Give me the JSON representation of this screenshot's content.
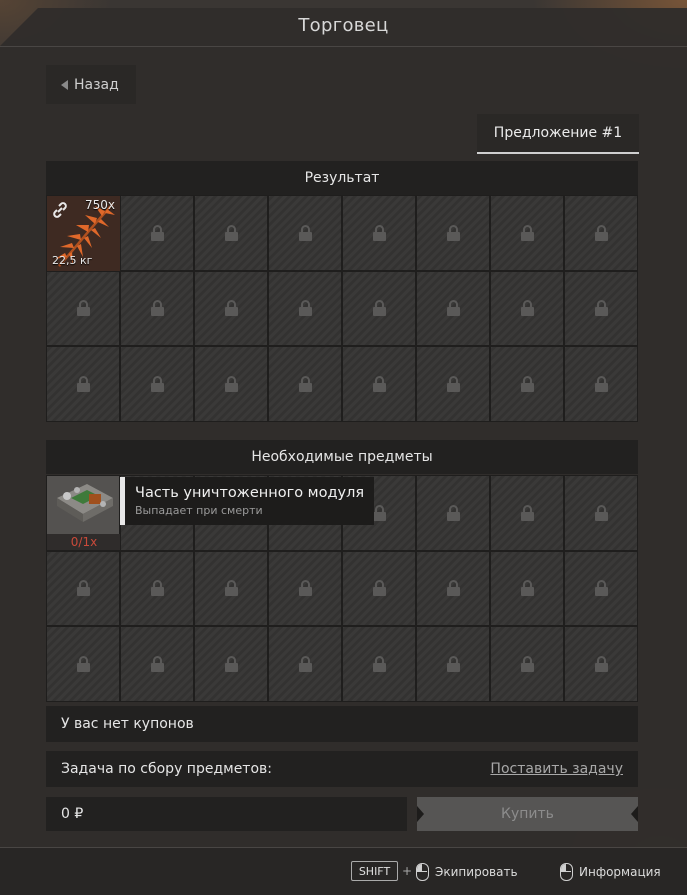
{
  "window": {
    "title": "Торговец"
  },
  "nav": {
    "back_label": "Назад"
  },
  "tabs": [
    {
      "label": "Предложение #1",
      "active": true
    }
  ],
  "result": {
    "header": "Результат",
    "item": {
      "icon": "fern-icon",
      "quantity": "750x",
      "weight": "22,5 кг",
      "linked": true
    },
    "locked_slot_icon": "lock-icon"
  },
  "required": {
    "header": "Необходимые предметы",
    "item": {
      "icon": "module-icon",
      "count": "0/1x",
      "count_color": "#c94a3a"
    },
    "tooltip": {
      "title": "Часть уничтоженного модуля",
      "subtitle": "Выпадает при смерти"
    }
  },
  "coupons": {
    "text": "У вас нет купонов"
  },
  "task": {
    "label": "Задача по сбору предметов:",
    "action": "Поставить задачу"
  },
  "price": {
    "value": "0 ₽"
  },
  "buy": {
    "label": "Купить",
    "enabled": false
  },
  "footer": {
    "shift_key": "SHIFT",
    "plus": "+",
    "equip_label": "Экипировать",
    "info_label": "Информация"
  }
}
